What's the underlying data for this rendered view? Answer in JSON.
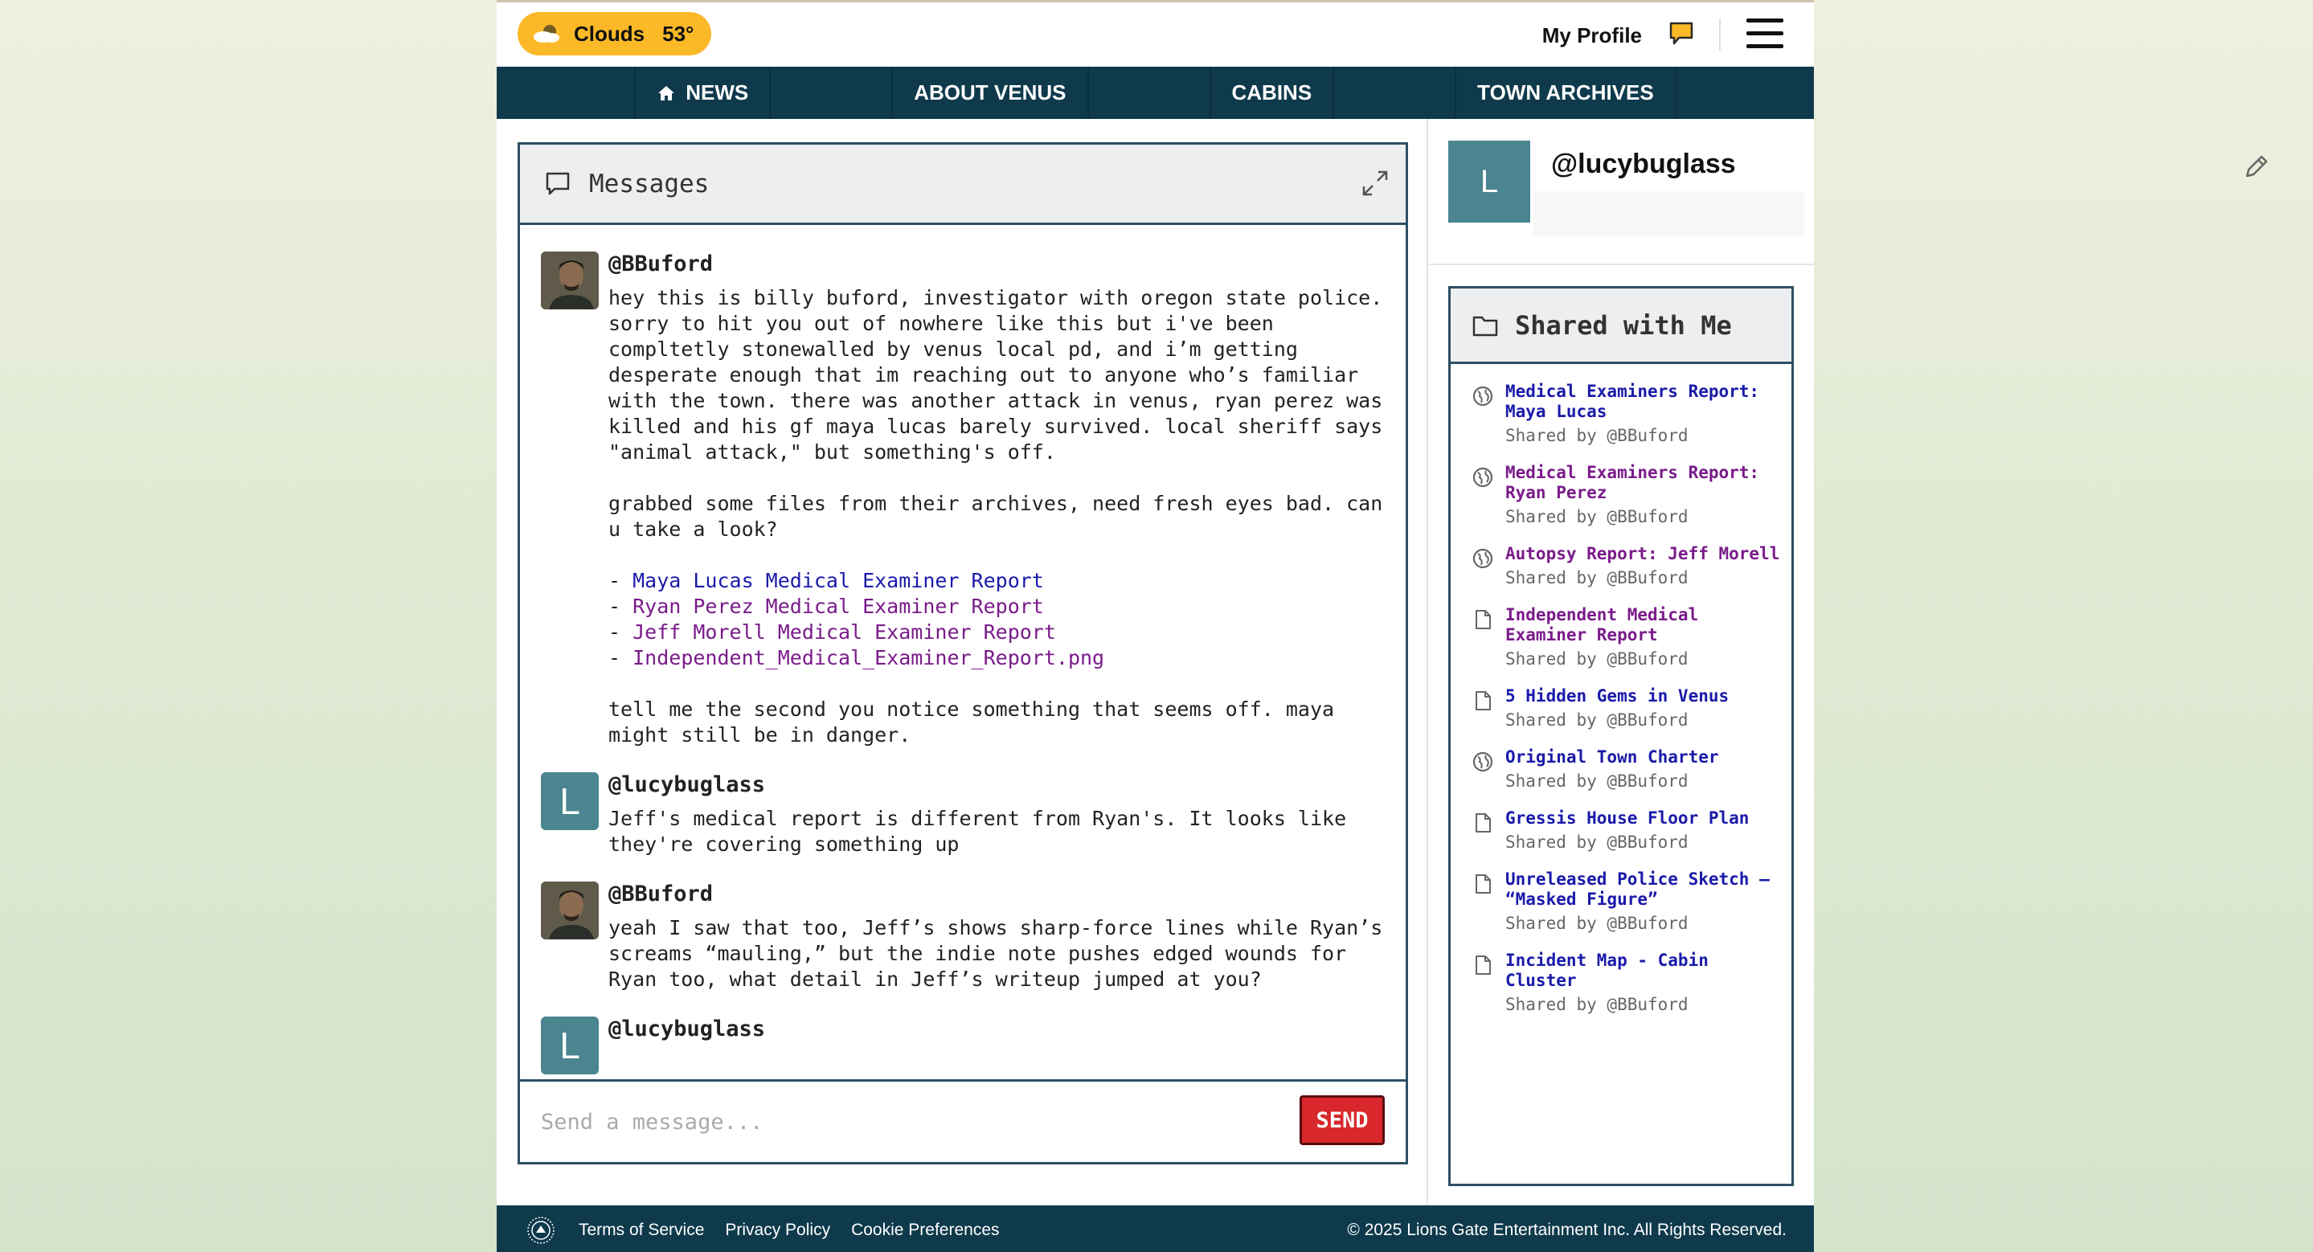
{
  "topbar": {
    "weather_label": "Clouds",
    "weather_temp": "53°",
    "weather_icon": "cloud-icon",
    "profile_label": "My Profile",
    "chat_icon": "chat-bubble-icon",
    "menu_icon": "hamburger-icon"
  },
  "nav": {
    "items": [
      "NEWS",
      "ABOUT VENUS",
      "CABINS",
      "TOWN ARCHIVES"
    ],
    "news_icon": "home-icon",
    "bg_color": "#0f3a4c"
  },
  "messages": {
    "title": "Messages",
    "input_placeholder": "Send a message...",
    "send_label": "SEND",
    "thread": [
      {
        "author": "@BBuford",
        "text_1": "hey this is billy buford, investigator with oregon state police.\nsorry to hit you out of nowhere like this but i've been\ncompltetly stonewalled by venus local pd, and i’m getting\ndesperate enough that im reaching out to anyone who’s familiar\nwith the town. there was another attack in venus, ryan perez was\nkilled and his gf maya lucas barely survived. local sheriff says\n\"animal attack,\" but something's off.\n\ngrabbed some files from their archives, need fresh eyes bad. can\nu take a look?\n",
        "links": [
          "Maya Lucas Medical Examiner Report",
          "Ryan Perez Medical Examiner Report",
          "Jeff Morell Medical Examiner Report",
          "Independent_Medical_Examiner_Report.png"
        ],
        "text_2": "tell me the second you notice something that seems off. maya\nmight still be in danger."
      },
      {
        "author": "@lucybuglass",
        "avatar_letter": "L",
        "text": "Jeff's medical report is different from Ryan's. It looks like\nthey're covering something up"
      },
      {
        "author": "@BBuford",
        "text": "yeah I saw that too, Jeff’s shows sharp-force lines while Ryan’s\nscreams “mauling,” but the indie note pushes edged wounds for\nRyan too, what detail in Jeff’s writeup jumped at you?"
      },
      {
        "author": "@lucybuglass",
        "avatar_letter": "L",
        "text": ""
      }
    ]
  },
  "user": {
    "avatar_letter": "L",
    "handle": "@lucybuglass",
    "edit_icon": "pencil-icon"
  },
  "shared": {
    "title": "Shared with Me",
    "items": [
      {
        "title": "Medical Examiners Report: Maya Lucas",
        "by": "Shared by @BBuford",
        "icon": "globe-icon"
      },
      {
        "title": "Medical Examiners Report: Ryan Perez",
        "by": "Shared by @BBuford",
        "icon": "globe-icon"
      },
      {
        "title": "Autopsy Report: Jeff Morell",
        "by": "Shared by @BBuford",
        "icon": "globe-icon"
      },
      {
        "title": "Independent Medical Examiner Report",
        "by": "Shared by @BBuford",
        "icon": "document-icon"
      },
      {
        "title": "5 Hidden Gems in Venus",
        "by": "Shared by @BBuford",
        "icon": "document-icon"
      },
      {
        "title": "Original Town Charter",
        "by": "Shared by @BBuford",
        "icon": "globe-icon"
      },
      {
        "title": "Gressis House Floor Plan",
        "by": "Shared by @BBuford",
        "icon": "document-icon"
      },
      {
        "title": "Unreleased Police Sketch – “Masked Figure”",
        "by": "Shared by @BBuford",
        "icon": "document-icon"
      },
      {
        "title": "Incident Map - Cabin Cluster",
        "by": "Shared by @BBuford",
        "icon": "document-icon"
      }
    ]
  },
  "footer": {
    "links": [
      "Terms of Service",
      "Privacy Policy",
      "Cookie Preferences"
    ],
    "copyright": "© 2025 Lions Gate Entertainment Inc. All Rights Reserved."
  },
  "colors": {
    "accent_yellow": "#fbb928",
    "panel_border": "#2d4f63",
    "send_red": "#d8282b",
    "link_blue": "#1a1aaa",
    "link_visited": "#7a1b8a"
  }
}
